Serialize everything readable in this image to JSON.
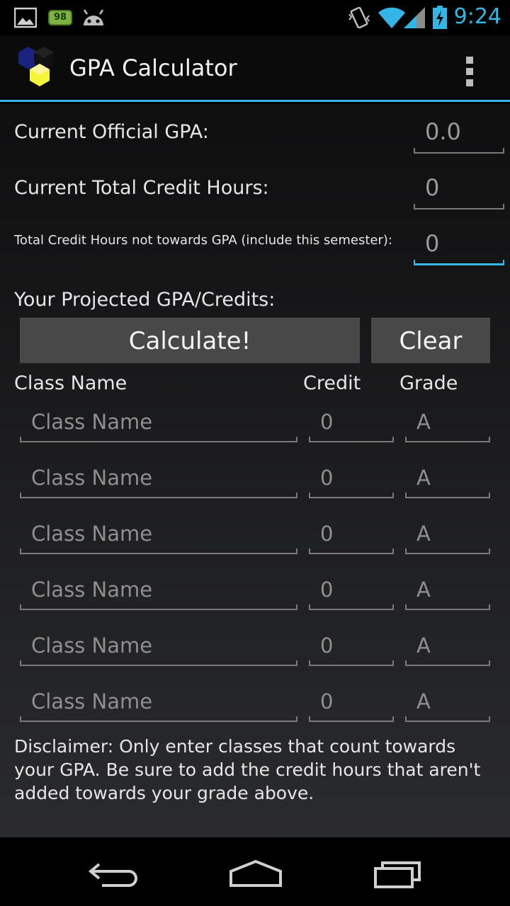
{
  "status_bar": {
    "time": "9:24",
    "battery_badge": "98",
    "icons": [
      "gallery-icon",
      "battery-badge-icon",
      "android-icon",
      "vibrate-icon",
      "wifi-icon",
      "signal-icon",
      "battery-charging-icon"
    ]
  },
  "action_bar": {
    "title": "GPA Calculator",
    "overflow_icon": "overflow-menu-icon"
  },
  "form": {
    "official_gpa_label": "Current Official GPA:",
    "official_gpa_value": "0.0",
    "total_credits_label": "Current Total Credit Hours:",
    "total_credits_value": "0",
    "non_gpa_credits_label": "Total Credit Hours not towards GPA (include this semester):",
    "non_gpa_credits_value": "0",
    "projected_label": "Your Projected GPA/Credits:"
  },
  "buttons": {
    "calculate": "Calculate!",
    "clear": "Clear"
  },
  "table": {
    "headers": {
      "name": "Class Name",
      "credit": "Credit",
      "grade": "Grade"
    },
    "rows": [
      {
        "name_placeholder": "Class Name",
        "credit_placeholder": "0",
        "grade_placeholder": "A"
      },
      {
        "name_placeholder": "Class Name",
        "credit_placeholder": "0",
        "grade_placeholder": "A"
      },
      {
        "name_placeholder": "Class Name",
        "credit_placeholder": "0",
        "grade_placeholder": "A"
      },
      {
        "name_placeholder": "Class Name",
        "credit_placeholder": "0",
        "grade_placeholder": "A"
      },
      {
        "name_placeholder": "Class Name",
        "credit_placeholder": "0",
        "grade_placeholder": "A"
      },
      {
        "name_placeholder": "Class Name",
        "credit_placeholder": "0",
        "grade_placeholder": "A"
      }
    ]
  },
  "disclaimer": {
    "line1": "Disclaimer: Only enter classes that count towards",
    "line2": "your GPA. Be sure to add the credit hours that aren't",
    "line3": "added towards your grade above."
  },
  "nav_bar": {
    "icons": [
      "back-icon",
      "home-icon",
      "recent-apps-icon"
    ]
  },
  "colors": {
    "accent": "#33b5e5",
    "background_top": "#0f0f10",
    "background_bottom": "#2a2b2d",
    "button": "#484848"
  }
}
